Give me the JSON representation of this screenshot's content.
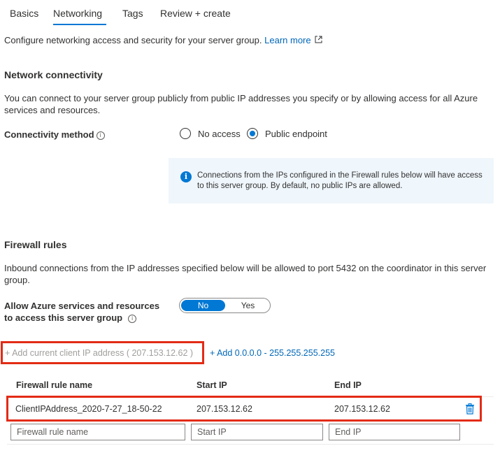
{
  "tabs": [
    {
      "label": "Basics",
      "active": false
    },
    {
      "label": "Networking",
      "active": true
    },
    {
      "label": "Tags",
      "active": false
    },
    {
      "label": "Review + create",
      "active": false
    }
  ],
  "intro": {
    "text": "Configure networking access and security for your server group.",
    "learn_more": "Learn more"
  },
  "network_connectivity": {
    "title": "Network connectivity",
    "description": "You can connect to your server group publicly from public IP addresses you specify or by allowing access for all Azure services and resources.",
    "connectivity_label": "Connectivity method",
    "options": [
      {
        "label": "No access",
        "selected": false
      },
      {
        "label": "Public endpoint",
        "selected": true
      }
    ],
    "info": "Connections from the IPs configured in the Firewall rules below will have access to this server group. By default, no public IPs are allowed."
  },
  "firewall": {
    "title": "Firewall rules",
    "description": "Inbound connections from the IP addresses specified below will be allowed to port 5432 on the coordinator in this server group.",
    "allow_label": "Allow Azure services and resources to access this server group",
    "toggle": {
      "off_label": "No",
      "on_label": "Yes",
      "value": "No"
    },
    "add_client_ip": "+ Add current client IP address ( 207.153.12.62 )",
    "add_range": "+ Add 0.0.0.0 - 255.255.255.255",
    "columns": [
      "Firewall rule name",
      "Start IP",
      "End IP"
    ],
    "rows": [
      {
        "name": "ClientIPAddress_2020-7-27_18-50-22",
        "start_ip": "207.153.12.62",
        "end_ip": "207.153.12.62"
      }
    ],
    "new_row_placeholders": {
      "name": "Firewall rule name",
      "start_ip": "Start IP",
      "end_ip": "End IP"
    }
  },
  "colors": {
    "accent": "#0078d4",
    "link": "#0067b8",
    "highlight": "#e32b15",
    "info_background": "#eff6fc"
  },
  "icons": {
    "external_link": "external-link-icon",
    "info": "info-icon",
    "delete": "trash-icon"
  }
}
